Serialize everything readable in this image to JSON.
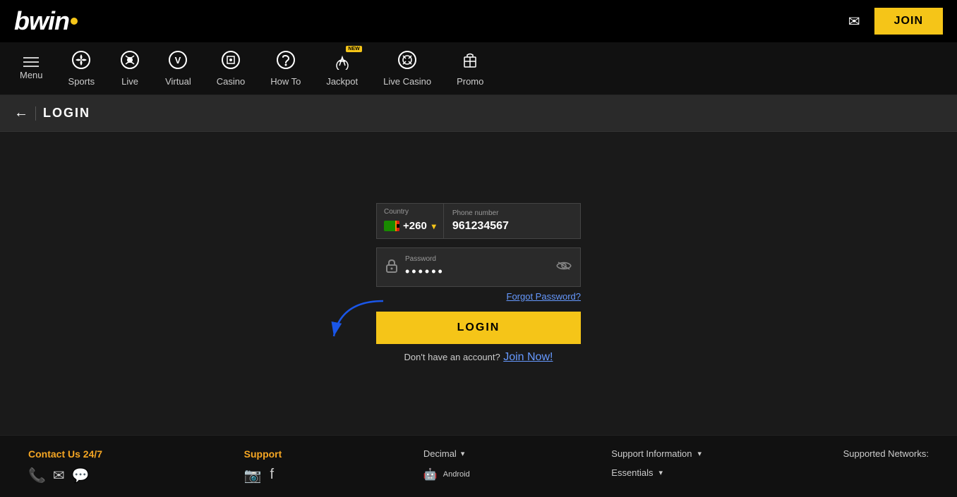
{
  "header": {
    "logo_text": "bwin",
    "join_label": "JOIN",
    "email_icon": "✉"
  },
  "nav": {
    "items": [
      {
        "id": "menu",
        "label": "Menu",
        "icon": "☰"
      },
      {
        "id": "sports",
        "label": "Sports",
        "icon": "⚽"
      },
      {
        "id": "live",
        "label": "Live",
        "icon": "📡"
      },
      {
        "id": "virtual",
        "label": "Virtual",
        "icon": "V"
      },
      {
        "id": "casino",
        "label": "Casino",
        "icon": "🎰"
      },
      {
        "id": "how-to",
        "label": "How To",
        "icon": "🤿"
      },
      {
        "id": "jackpot",
        "label": "Jackpot",
        "icon": "🎡",
        "badge": "NEW"
      },
      {
        "id": "live-casino",
        "label": "Live Casino",
        "icon": "🎰"
      },
      {
        "id": "promo",
        "label": "Promo",
        "icon": "🎁"
      }
    ]
  },
  "breadcrumb": {
    "back_icon": "←",
    "title": "LOGIN"
  },
  "login": {
    "country_label": "Country",
    "country_value": "+260",
    "phone_label": "Phone number",
    "phone_value": "961234567",
    "password_label": "Password",
    "password_value": "••••••",
    "forgot_label": "Forgot Password?",
    "login_btn": "LOGIN",
    "no_account_text": "Don't have an account?",
    "join_now_label": "Join Now!"
  },
  "footer": {
    "contact_label": "Contact Us 24/7",
    "support_label": "Support",
    "decimal_label": "Decimal",
    "support_info_label": "Support Information",
    "essentials_label": "Essentials",
    "networks_label": "Supported Networks:"
  }
}
